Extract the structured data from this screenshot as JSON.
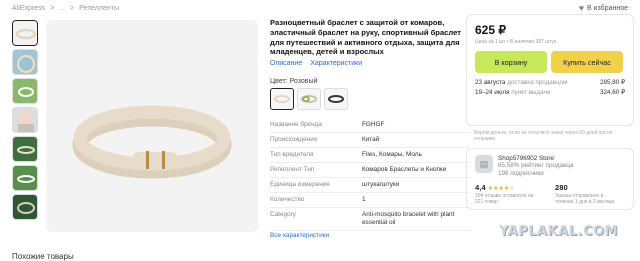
{
  "breadcrumb": {
    "home": "AliExpress",
    "sep1": ">",
    "ellipsis": "...",
    "sep2": ">",
    "current": "Репелленты"
  },
  "favorites": {
    "label": "В избранное",
    "icon": "heart-icon"
  },
  "product": {
    "title": "Разноцветный браслет с защитой от комаров, эластичный браслет на руку, спортивный браслет для путешествий и активного отдыха, защита для младенцев, детей и взрослых",
    "tabs": [
      "Описание",
      "Характеристики"
    ],
    "color_label": "Цвет: Розовый",
    "specs": [
      {
        "k": "Название бренда",
        "v": "FGHGF"
      },
      {
        "k": "Происхождение",
        "v": "Китай"
      },
      {
        "k": "Тип вредителя",
        "v": "Files, Комары, Моль"
      },
      {
        "k": "Репеллент Тип",
        "v": "Комаров Браслеты и Кнопки"
      },
      {
        "k": "Единица измерения",
        "v": "штука/штуки"
      },
      {
        "k": "Количество",
        "v": "1"
      },
      {
        "k": "Category",
        "v": "Anti-mosquito bracelet with plant essential oil"
      }
    ],
    "all_specs_link": "Все характеристики"
  },
  "buy": {
    "price": "625 ₽",
    "price_note": "Цена за 1 шт • В наличии 397 штук",
    "cart_btn": "В корзину",
    "buy_btn": "Купить сейчас",
    "ship1": {
      "date": "23 августа",
      "sub": "доставка продавцом",
      "price": "285,80 ₽"
    },
    "ship2": {
      "date": "19–24 июля",
      "sub": "пункт выдачи",
      "price": "324,60 ₽"
    }
  },
  "return_note": "Верём деньги, если не получите заказ через 60 дней после отправки.",
  "store": {
    "name": "Shop5796902 Store",
    "rating_line": "65,58% рейтинг продавца",
    "followers": "198 подписчики",
    "score": "4,4",
    "stars": "★★★★☆",
    "score_sub": "104 отзыва оставлено на 321 товар",
    "count": "280",
    "count_sub": "Заказа отправлено в течение 1 дня в 2 месяца"
  },
  "watermark": "YAPLAKAL.COM",
  "footer_text": "Похожие товары",
  "colors": {
    "accent_green": "#c6e85a",
    "accent_yellow": "#f2d14a",
    "link": "#2a6bd6",
    "bracelet": "#e7dccb"
  }
}
